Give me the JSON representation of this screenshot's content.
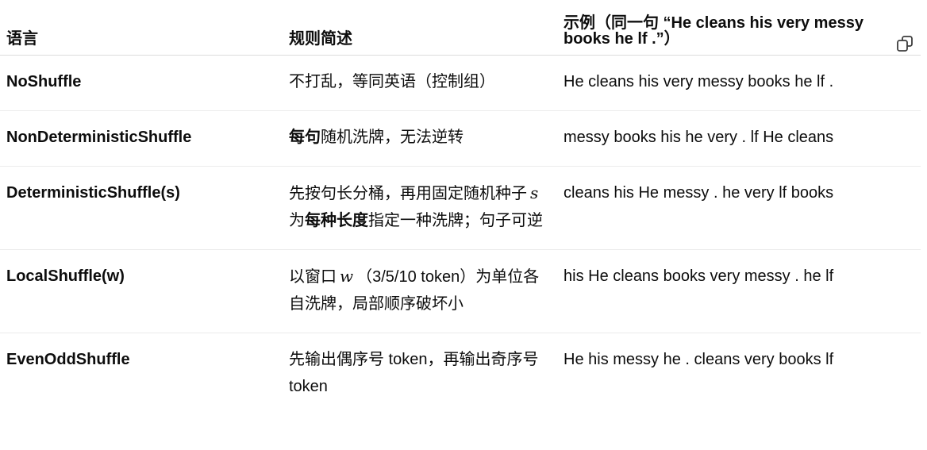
{
  "table": {
    "headers": {
      "language": "语言",
      "rule": "规则简述",
      "example": "示例（同一句 “He cleans his very messy books he lf .”）"
    },
    "rows": [
      {
        "language": "NoShuffle",
        "rule": {
          "pre": "不打乱，等同英语（控制组）"
        },
        "example": "He cleans his very messy books he lf ."
      },
      {
        "language": "NonDeterministicShuffle",
        "rule": {
          "bold": "每句",
          "post": "随机洗牌，无法逆转"
        },
        "example": "messy books his he very . lf He cleans"
      },
      {
        "language": "DeterministicShuffle(s)",
        "rule": {
          "pre": "先按句长分桶，再用固定随机种子",
          "var": "s",
          "mid": "为",
          "bold": "每种长度",
          "post": "指定一种洗牌；句子可逆"
        },
        "example": "cleans his He messy . he very lf books"
      },
      {
        "language": "LocalShuffle(w)",
        "rule": {
          "pre": "以窗口",
          "var": "w",
          "post": "（3/5/10 token）为单位各自洗牌，局部顺序破坏小"
        },
        "example": "his He cleans books very messy . he lf"
      },
      {
        "language": "EvenOddShuffle",
        "rule": {
          "pre": "先输出偶序号 token，再输出奇序号 token"
        },
        "example": "He his messy he . cleans very books lf"
      }
    ]
  },
  "copy_button": {
    "icon": "copy-icon"
  }
}
